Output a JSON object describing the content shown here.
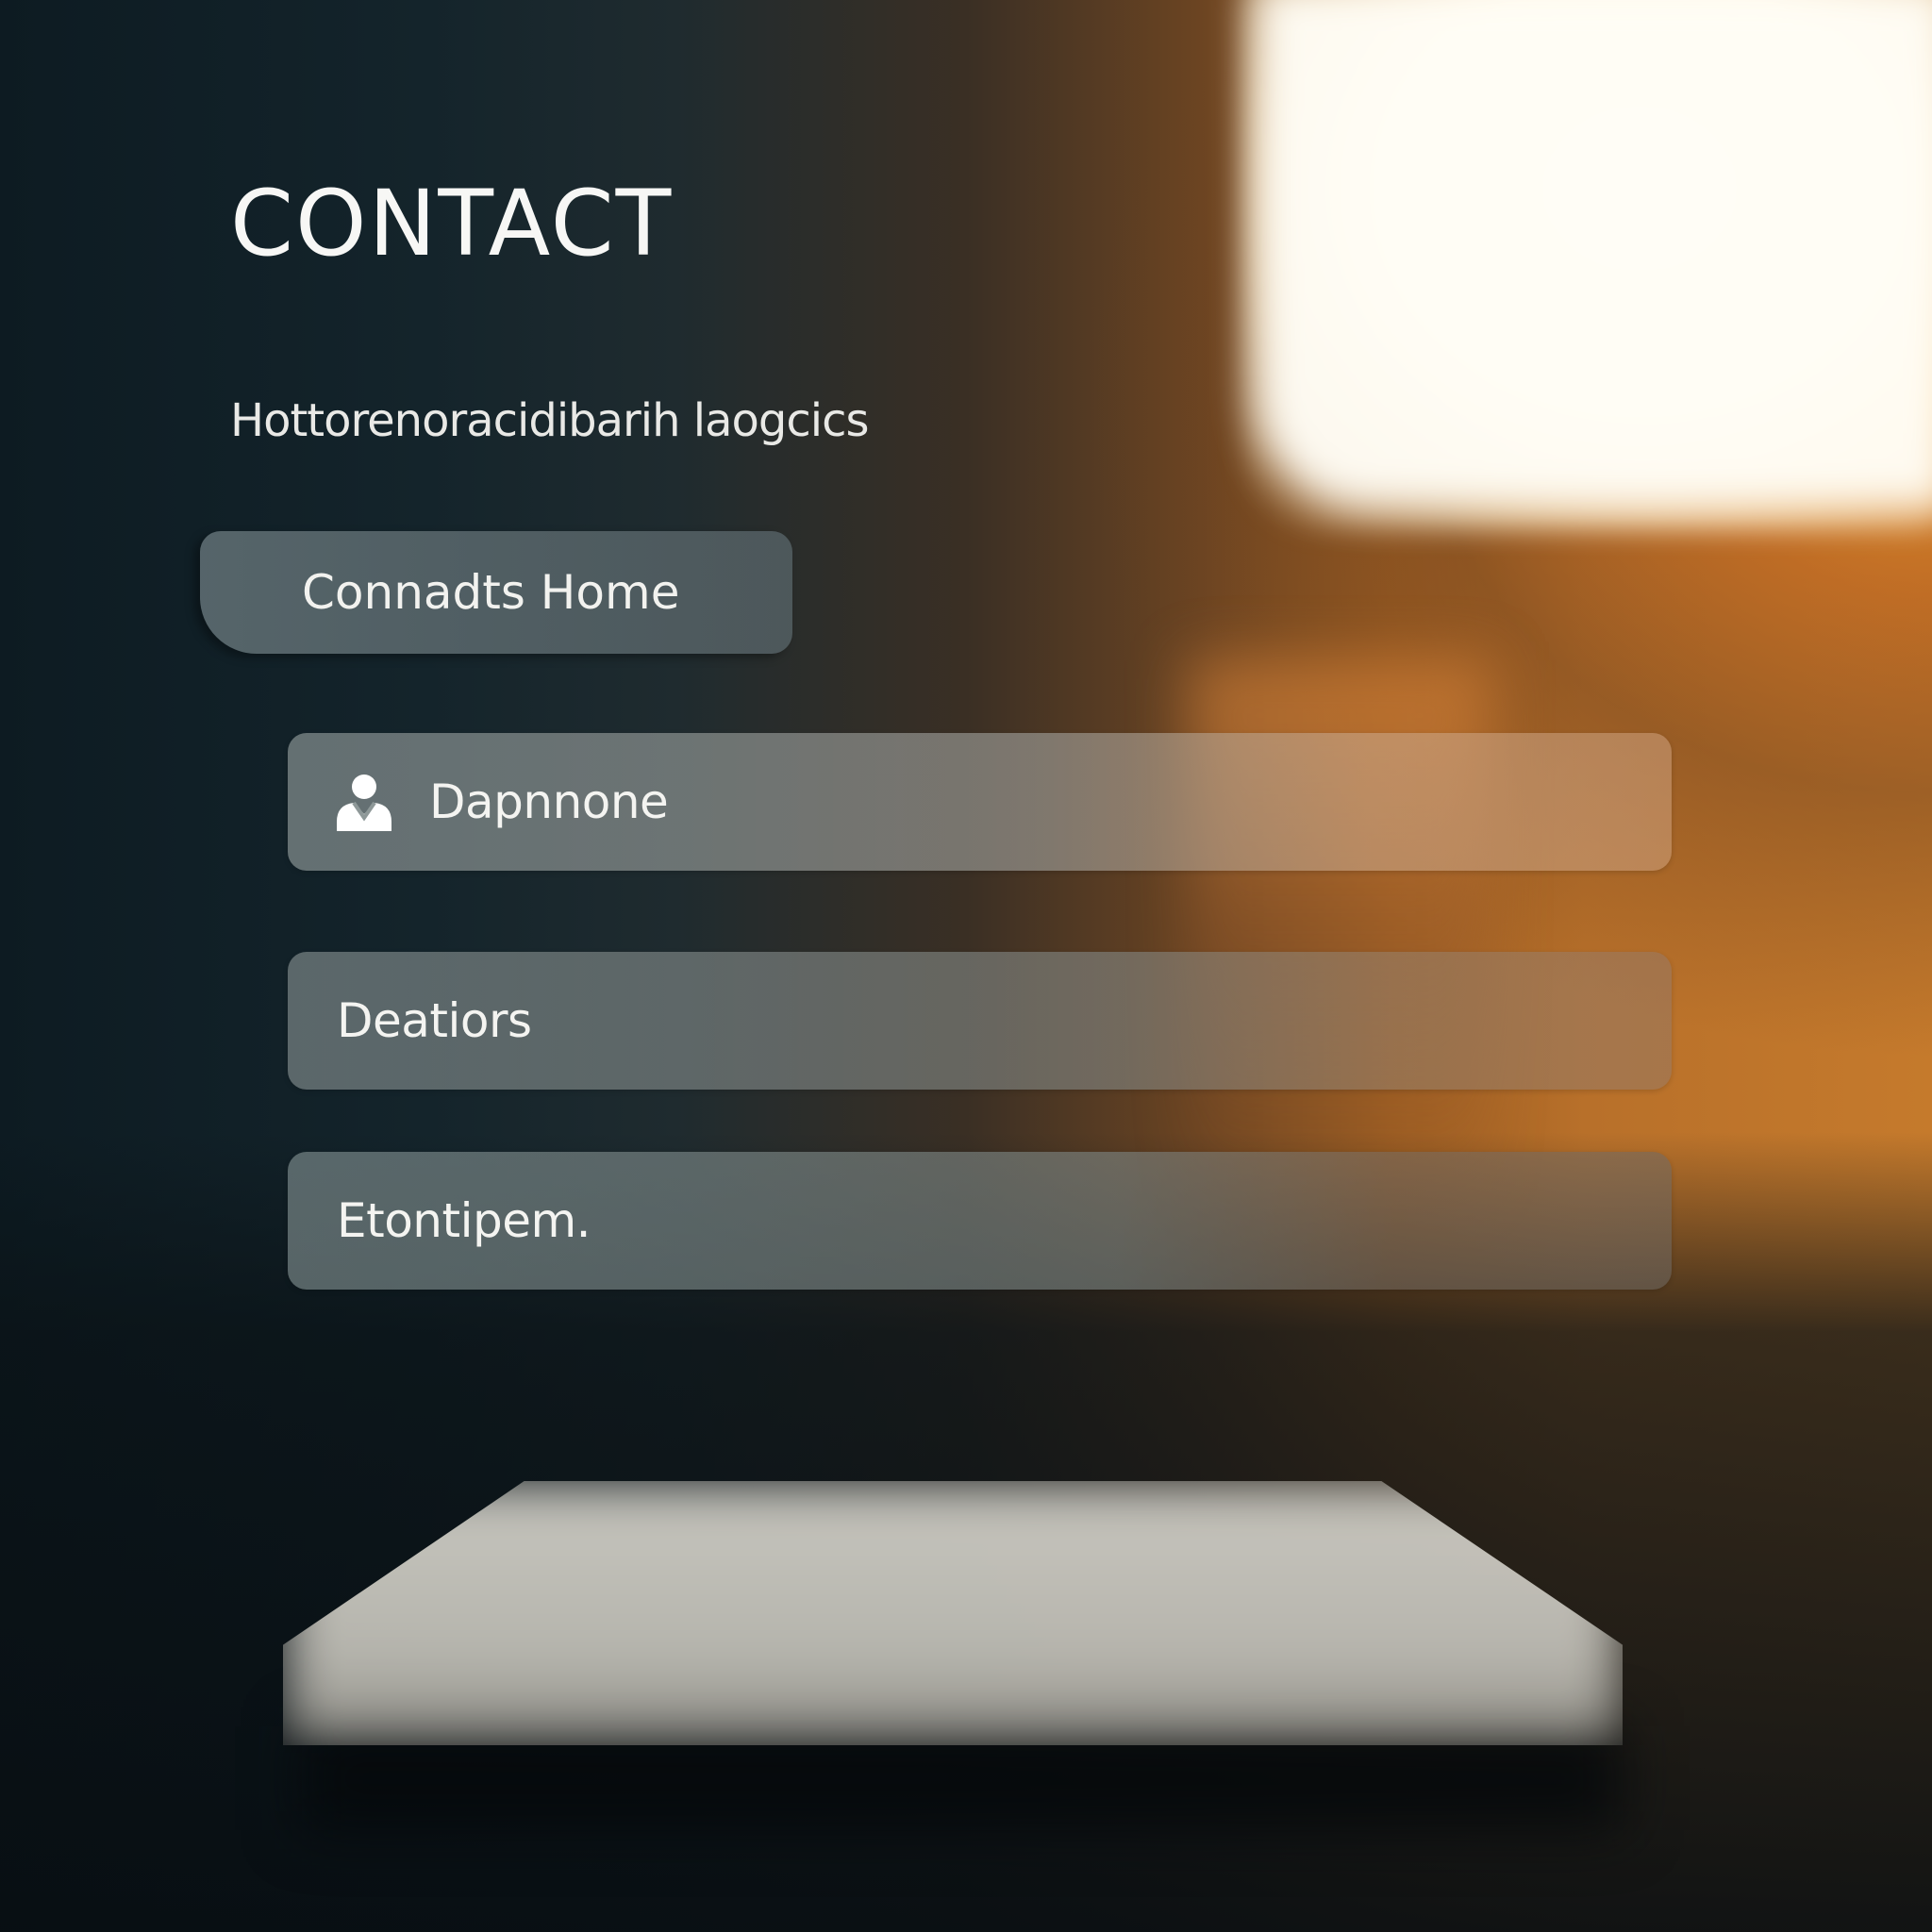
{
  "header": {
    "title": "CONTACT",
    "subtitle": "Hottorenoracidibarih laogcics"
  },
  "primary_button": {
    "label": "Connadts Home"
  },
  "fields": [
    {
      "icon": "person-icon",
      "text": "Dapnnone"
    },
    {
      "icon": "",
      "text": "Deatiors"
    },
    {
      "icon": "",
      "text": "Etontipem."
    }
  ],
  "colors": {
    "accent_orange": "#c57a2c",
    "background_dark": "#0d1b22",
    "field_tint": "#9aa3a3"
  }
}
